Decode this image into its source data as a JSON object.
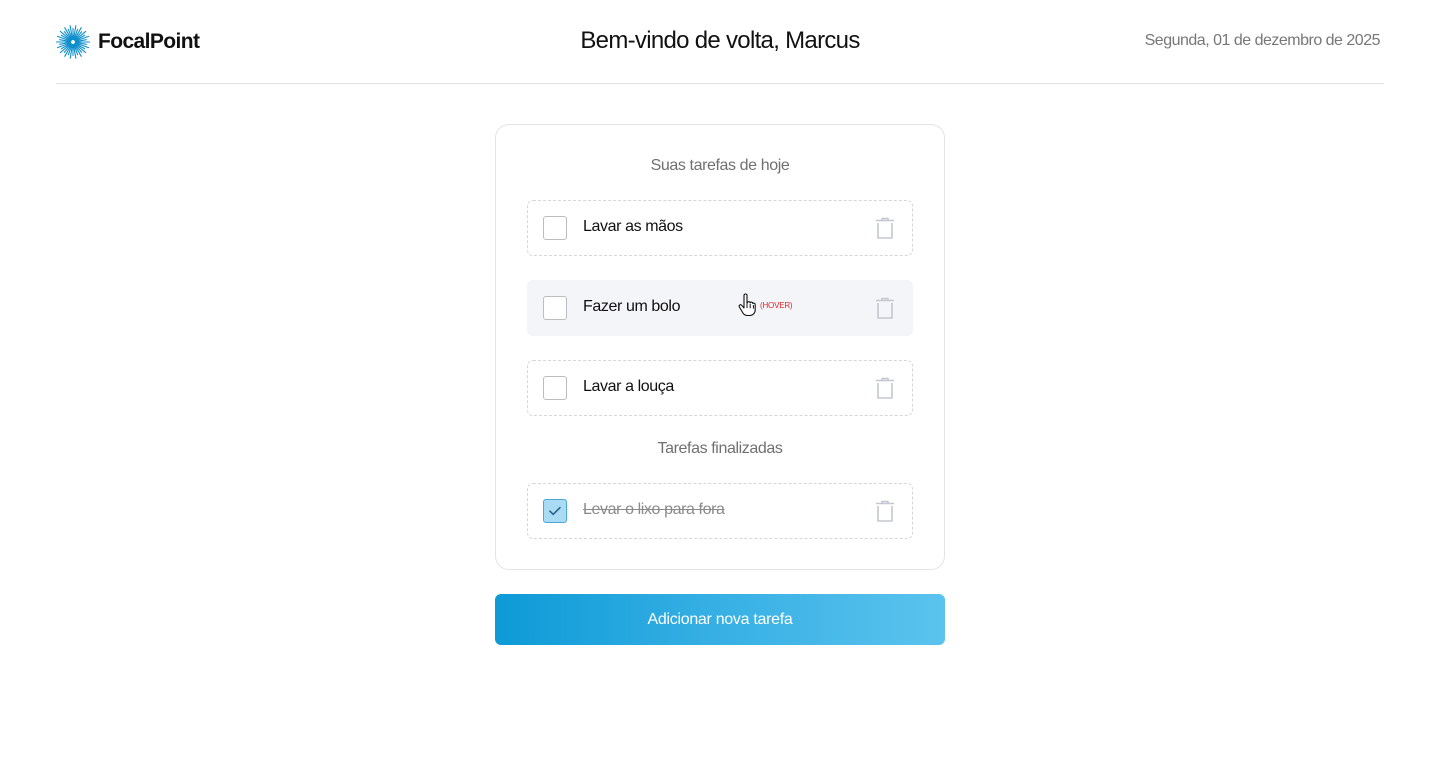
{
  "header": {
    "brand_name": "FocalPoint",
    "welcome": "Bem-vindo de volta, Marcus",
    "date": "Segunda, 01 de dezembro de 2025"
  },
  "today": {
    "title": "Suas tarefas de hoje",
    "tasks": [
      {
        "label": "Lavar as mãos",
        "checked": false
      },
      {
        "label": "Fazer um bolo",
        "checked": false
      },
      {
        "label": "Lavar a louça",
        "checked": false
      }
    ]
  },
  "hover_tag": "(HOVER)",
  "finished": {
    "title": "Tarefas finalizadas",
    "tasks": [
      {
        "label": "Levar o lixo para fora",
        "checked": true
      }
    ]
  },
  "add_button_label": "Adicionar nova tarefa",
  "colors": {
    "accent": "#0d9ad6",
    "accent_light": "#5bc3ee",
    "checked_fill": "#a9dbf4",
    "hover_bg": "#f4f5f8",
    "hover_tag": "#e02424"
  },
  "icons": {
    "logo": "sunburst-logo-icon",
    "delete": "trash-icon",
    "check": "checkmark-icon",
    "cursor": "hand-pointer-icon"
  }
}
